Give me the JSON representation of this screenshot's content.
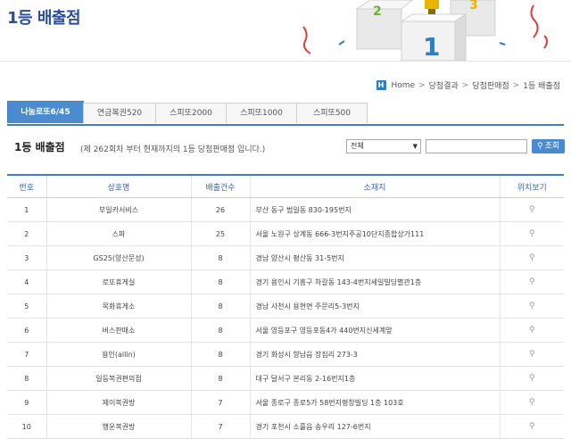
{
  "page": {
    "title": "1등 배출점"
  },
  "breadcrumb": {
    "icon": "home-icon",
    "items": [
      "Home",
      "당첨결과",
      "당첨판매점",
      "1등 배출점"
    ]
  },
  "tabs": [
    {
      "label": "나눔로또6/45",
      "active": true
    },
    {
      "label": "연금복권520",
      "active": false
    },
    {
      "label": "스피또2000",
      "active": false
    },
    {
      "label": "스피또1000",
      "active": false
    },
    {
      "label": "스피또500",
      "active": false
    }
  ],
  "section": {
    "title": "1등 배출점",
    "description": "(제 262회차 부터 현재까지의 1등 당첨판매점 입니다.)"
  },
  "filter": {
    "select_value": "전체",
    "input_value": "",
    "search_label": "조회"
  },
  "table": {
    "headers": [
      "번호",
      "상호명",
      "배출건수",
      "소재지",
      "위치보기"
    ],
    "rows": [
      {
        "no": "1",
        "name": "부일카서비스",
        "count": "26",
        "addr": "부산 동구 범일동 830-195번지"
      },
      {
        "no": "2",
        "name": "스파",
        "count": "25",
        "addr": "서울 노원구 상계동 666-3번지주공10단지종합상가111"
      },
      {
        "no": "3",
        "name": "GS25(양산문성)",
        "count": "8",
        "addr": "경남 양산시 평산동 31-5번지"
      },
      {
        "no": "4",
        "name": "로또휴게실",
        "count": "8",
        "addr": "경기 용인시 기흥구 하갈동 143-4번지세일빌딩별관1층"
      },
      {
        "no": "5",
        "name": "목화휴게소",
        "count": "8",
        "addr": "경남 사천시 용현면 주문리5-3번지"
      },
      {
        "no": "6",
        "name": "버스판매소",
        "count": "8",
        "addr": "서울 영등포구 영등포동4가 440번지신세계앞"
      },
      {
        "no": "7",
        "name": "용인(allin)",
        "count": "8",
        "addr": "경기 화성시 향남읍 장짐리 273-3"
      },
      {
        "no": "8",
        "name": "일등복권편의점",
        "count": "8",
        "addr": "대구 달서구 본리동 2-16번지1층"
      },
      {
        "no": "9",
        "name": "제이복권방",
        "count": "7",
        "addr": "서울 종로구 종로5가 58번지평창빌딩 1층 103호"
      },
      {
        "no": "10",
        "name": "행운복권방",
        "count": "7",
        "addr": "경기 포천시 소흘읍 송우리 127-6번지"
      }
    ]
  },
  "colors": {
    "accent": "#3f7fc1",
    "title": "#2a4d9c",
    "tab_active": "#4b8bd0"
  }
}
